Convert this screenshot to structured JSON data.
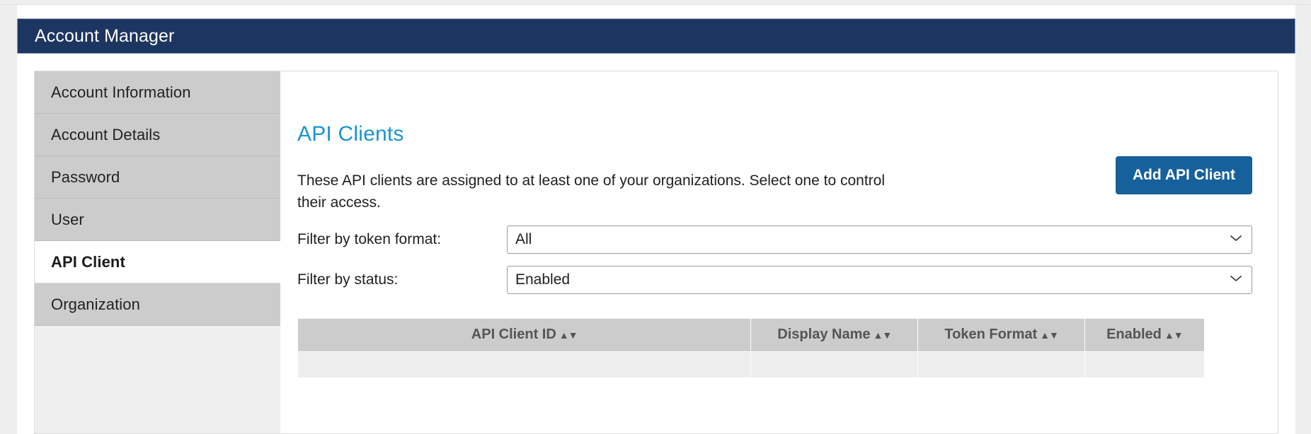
{
  "app": {
    "header_title": "Account Manager"
  },
  "sidebar": {
    "items": [
      {
        "label": "Account Information",
        "active": false
      },
      {
        "label": "Account Details",
        "active": false
      },
      {
        "label": "Password",
        "active": false
      },
      {
        "label": "User",
        "active": false
      },
      {
        "label": "API Client",
        "active": true
      },
      {
        "label": "Organization",
        "active": false
      }
    ]
  },
  "main": {
    "heading": "API Clients",
    "description": "These API clients are assigned to at least one of your organizations. Select one to control their access.",
    "add_button_label": "Add API Client",
    "filters": [
      {
        "label": "Filter by token format:",
        "value": "All",
        "icon": "chevron-down-icon"
      },
      {
        "label": "Filter by status:",
        "value": "Enabled",
        "icon": "chevron-down-icon"
      }
    ],
    "table": {
      "columns": [
        {
          "label": "API Client ID",
          "sort": "▲▼"
        },
        {
          "label": "Display Name",
          "sort": "▲▼"
        },
        {
          "label": "Token Format",
          "sort": "▲▼"
        },
        {
          "label": "Enabled",
          "sort": "▲▼"
        }
      ],
      "rows": []
    }
  },
  "colors": {
    "header_bg": "#1d3661",
    "heading_blue": "#1b94d2",
    "button_blue": "#16619b",
    "sidebar_item_bg": "#cccccc",
    "page_bg": "#eeeeee"
  }
}
